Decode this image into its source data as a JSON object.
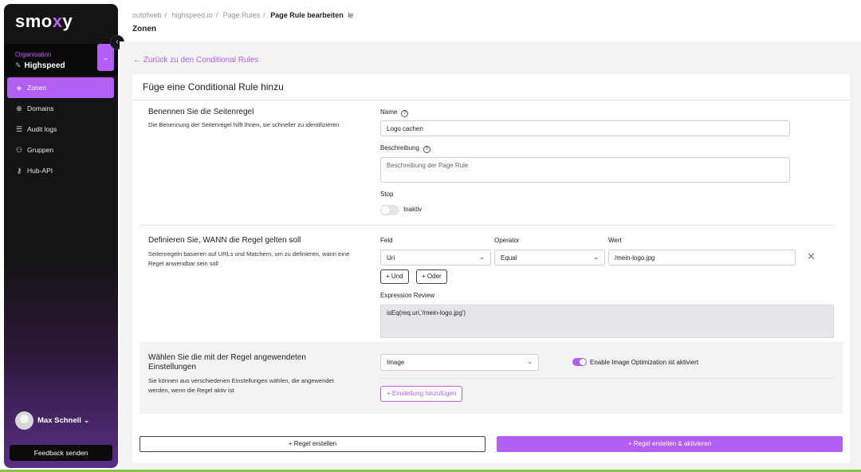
{
  "sidebar": {
    "logo": "smo",
    "logo_accent": "x",
    "logo_end": "y",
    "collapse_icon": "‹",
    "org_label": "Organisation",
    "org_name": "Highspeed",
    "nav": [
      {
        "label": "Zonen",
        "icon": "layers-icon",
        "active": true
      },
      {
        "label": "Domains",
        "icon": "globe-icon",
        "active": false
      },
      {
        "label": "Audit logs",
        "icon": "list-icon",
        "active": false
      },
      {
        "label": "Gruppen",
        "icon": "users-icon",
        "active": false
      },
      {
        "label": "Hub-API",
        "icon": "key-icon",
        "active": false
      }
    ],
    "user_name": "Max Schnell",
    "feedback": "Feedback senden"
  },
  "header": {
    "breadcrumb": [
      "outofweb",
      "highspeed.io",
      "Page Rules",
      "Page Rule bearbeiten"
    ],
    "breadcrumb_tail": "le",
    "page_heading": "Zonen"
  },
  "back_link": "Zurück zu den Conditional Rules",
  "card": {
    "title": "Füge eine Conditional Rule hinzu",
    "name_section": {
      "title": "Benennen Sie die Seitenregel",
      "description": "Die Benennung der Seitenregel hilft Ihnen, sie schneller zu identifizieren",
      "name_label": "Name",
      "name_value": "Logo cachen",
      "desc_label": "Beschreibung",
      "desc_placeholder": "Beschreibung der Page Rule",
      "stop_label": "Stop",
      "stop_state": "Inaktiv"
    },
    "when_section": {
      "title": "Definieren Sie, WANN die Regel gelten soll",
      "description": "Seitenregeln basieren auf URLs und Matchern, um zu definieren, wann eine Regel anwendbar sein soll",
      "field_label": "Feld",
      "operator_label": "Operator",
      "value_label": "Wert",
      "field_value": "Uri",
      "operator_value": "Equal",
      "value_value": "/mein-logo.jpg",
      "and_button": "+ Und",
      "or_button": "+ Oder",
      "expression_label": "Expression Review",
      "expression": "isEq(req.uri,'/mein-logo.jpg')"
    },
    "settings_section": {
      "title": "Wählen Sie die mit der Regel angewendeten Einstellungen",
      "description": "Sie können aus verschiedenen Einstellungen wählen, die angewendet werden, wenn die Regel aktiv ist",
      "setting_value": "Image",
      "toggle_label": "Enable Image Optimization ist aktiviert",
      "add_button": "+ Einstellung hinzufügen"
    },
    "footer": {
      "create": "+ Regel erstellen",
      "create_activate": "+ Regel erstellen & aktivieren"
    }
  },
  "colors": {
    "accent": "#b15ff4",
    "sidebar_bg": "#141414",
    "status_bar": "#8bc34a"
  }
}
